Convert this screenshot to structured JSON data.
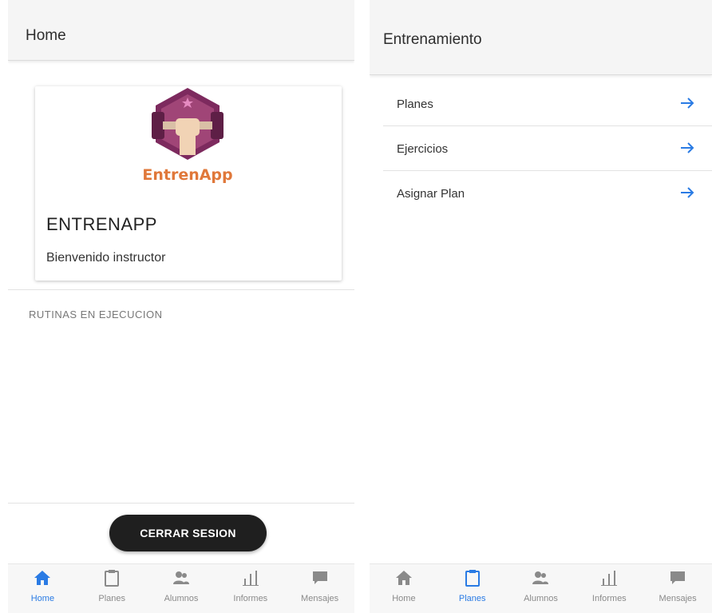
{
  "home": {
    "header_title": "Home",
    "card": {
      "logo_text": "EntrenApp",
      "title": "ENTRENAPP",
      "subtitle": "Bienvenido instructor"
    },
    "section_label": "RUTINAS EN EJECUCION",
    "logout_label": "CERRAR SESION",
    "nav": [
      {
        "label": "Home",
        "icon": "home-icon",
        "active": true
      },
      {
        "label": "Planes",
        "icon": "clipboard-icon",
        "active": false
      },
      {
        "label": "Alumnos",
        "icon": "users-icon",
        "active": false
      },
      {
        "label": "Informes",
        "icon": "bar-chart-icon",
        "active": false
      },
      {
        "label": "Mensajes",
        "icon": "chat-icon",
        "active": false
      }
    ]
  },
  "training": {
    "header_title": "Entrenamiento",
    "items": [
      {
        "label": "Planes"
      },
      {
        "label": "Ejercicios"
      },
      {
        "label": "Asignar Plan"
      }
    ],
    "nav": [
      {
        "label": "Home",
        "icon": "home-icon",
        "active": false
      },
      {
        "label": "Planes",
        "icon": "clipboard-icon",
        "active": true
      },
      {
        "label": "Alumnos",
        "icon": "users-icon",
        "active": false
      },
      {
        "label": "Informes",
        "icon": "bar-chart-icon",
        "active": false
      },
      {
        "label": "Mensajes",
        "icon": "chat-icon",
        "active": false
      }
    ]
  },
  "colors": {
    "accent": "#2a7be4",
    "inactive": "#8a8a8a",
    "logo_purple": "#7d2a5e",
    "logo_orange": "#e0783a"
  }
}
